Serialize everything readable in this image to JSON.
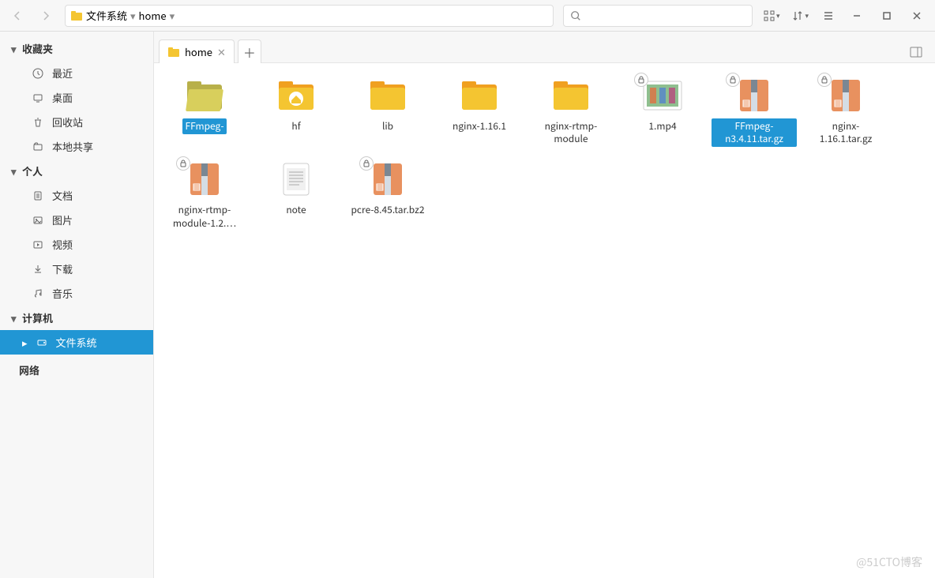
{
  "toolbar": {
    "path": [
      "文件系统",
      "home"
    ]
  },
  "sidebar": {
    "sections": [
      {
        "title": "收藏夹",
        "items": [
          "最近",
          "桌面",
          "回收站",
          "本地共享"
        ]
      },
      {
        "title": "个人",
        "items": [
          "文档",
          "图片",
          "视频",
          "下载",
          "音乐"
        ]
      },
      {
        "title": "计算机",
        "items": [
          "文件系统"
        ]
      }
    ],
    "network": "网络"
  },
  "tabs": {
    "current": "home"
  },
  "files": [
    {
      "name": "FFmpeg-",
      "type": "folder-open",
      "selected": true
    },
    {
      "name": "hf",
      "type": "folder-home",
      "selected": false
    },
    {
      "name": "lib",
      "type": "folder",
      "selected": false
    },
    {
      "name": "nginx-1.16.1",
      "type": "folder",
      "selected": false
    },
    {
      "name": "nginx-rtmp-module",
      "type": "folder",
      "selected": false
    },
    {
      "name": "1.mp4",
      "type": "video",
      "selected": false,
      "locked": true
    },
    {
      "name": "FFmpeg-n3.4.11.tar.gz",
      "type": "archive",
      "selected": true,
      "locked": true
    },
    {
      "name": "nginx-1.16.1.tar.gz",
      "type": "archive",
      "selected": false,
      "locked": true
    },
    {
      "name": "nginx-rtmp-module-1.2.…",
      "type": "archive",
      "selected": false,
      "locked": true
    },
    {
      "name": "note",
      "type": "text",
      "selected": false
    },
    {
      "name": "pcre-8.45.tar.bz2",
      "type": "archive",
      "selected": false,
      "locked": true
    }
  ],
  "watermark": "@51CTO博客"
}
